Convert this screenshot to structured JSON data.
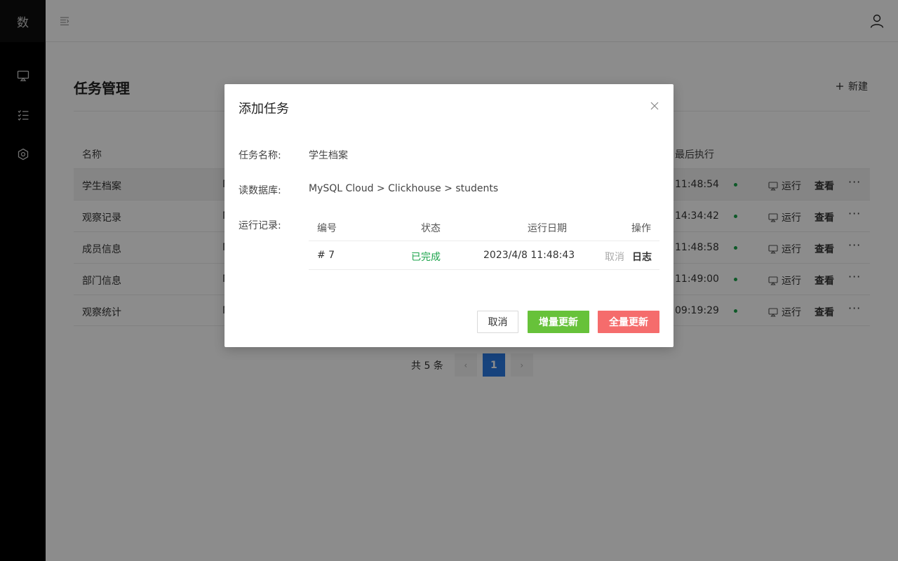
{
  "sidebar": {
    "logo": "数",
    "items": [
      {
        "icon": "monitor-icon"
      },
      {
        "icon": "task-list-icon"
      },
      {
        "icon": "settings-icon"
      }
    ]
  },
  "header": {
    "collapse_icon": "menu-collapse-icon",
    "user_icon": "user-icon"
  },
  "page": {
    "title": "任务管理",
    "new_button": "新建",
    "table": {
      "headers": {
        "name": "名称",
        "last_run": "最后执行"
      },
      "rows": [
        {
          "name": "学生档案",
          "trunc": "M",
          "time": "11:48:54",
          "run": "运行",
          "view": "查看",
          "more": "···"
        },
        {
          "name": "观察记录",
          "trunc": "M",
          "time": "14:34:42",
          "run": "运行",
          "view": "查看",
          "more": "···"
        },
        {
          "name": "成员信息",
          "trunc": "M",
          "time": "11:48:58",
          "run": "运行",
          "view": "查看",
          "more": "···"
        },
        {
          "name": "部门信息",
          "trunc": "M",
          "time": "11:49:00",
          "run": "运行",
          "view": "查看",
          "more": "···"
        },
        {
          "name": "观察统计",
          "trunc": "M",
          "time": "09:19:29",
          "run": "运行",
          "view": "查看",
          "more": "···"
        }
      ]
    },
    "pagination": {
      "total": "共 5 条",
      "prev": "‹",
      "current": "1",
      "next": "›"
    }
  },
  "modal": {
    "title": "添加任务",
    "task_name_label": "任务名称:",
    "task_name_value": "学生档案",
    "source_label": "读数据库:",
    "source_value": "MySQL Cloud > Clickhouse > students",
    "records_label": "运行记录:",
    "records": {
      "headers": {
        "id": "编号",
        "status": "状态",
        "date": "运行日期",
        "actions": "操作"
      },
      "rows": [
        {
          "id": "# 7",
          "status": "已完成",
          "date": "2023/4/8 11:48:43",
          "cancel": "取消",
          "log": "日志"
        }
      ]
    },
    "buttons": {
      "cancel": "取消",
      "incremental": "增量更新",
      "full": "全量更新"
    },
    "colors": {
      "success": "#1aa34a",
      "incremental": "#67c23a",
      "full": "#f56c6c",
      "page_active": "#2a7be4"
    }
  }
}
